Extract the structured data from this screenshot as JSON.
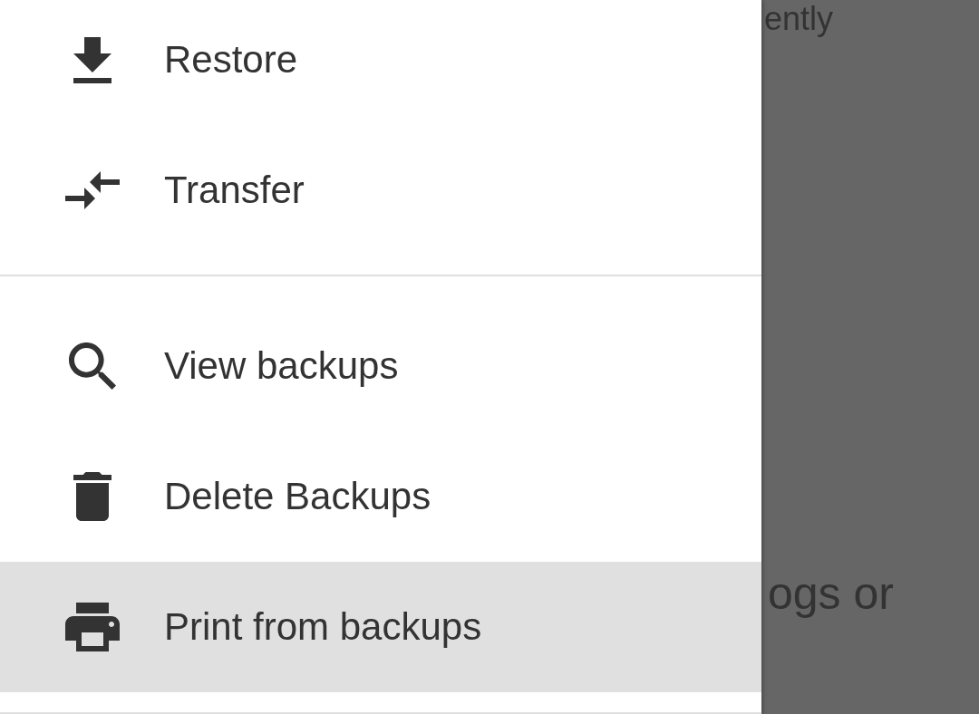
{
  "drawer": {
    "groups": [
      {
        "items": [
          {
            "label": "Restore",
            "selected": false
          },
          {
            "label": "Transfer",
            "selected": false
          }
        ]
      },
      {
        "items": [
          {
            "label": "View backups",
            "selected": false
          },
          {
            "label": "Delete Backups",
            "selected": false
          },
          {
            "label": "Print from backups",
            "selected": true
          }
        ]
      }
    ]
  },
  "background": {
    "texts": [
      "ently",
      "ogs or"
    ]
  }
}
